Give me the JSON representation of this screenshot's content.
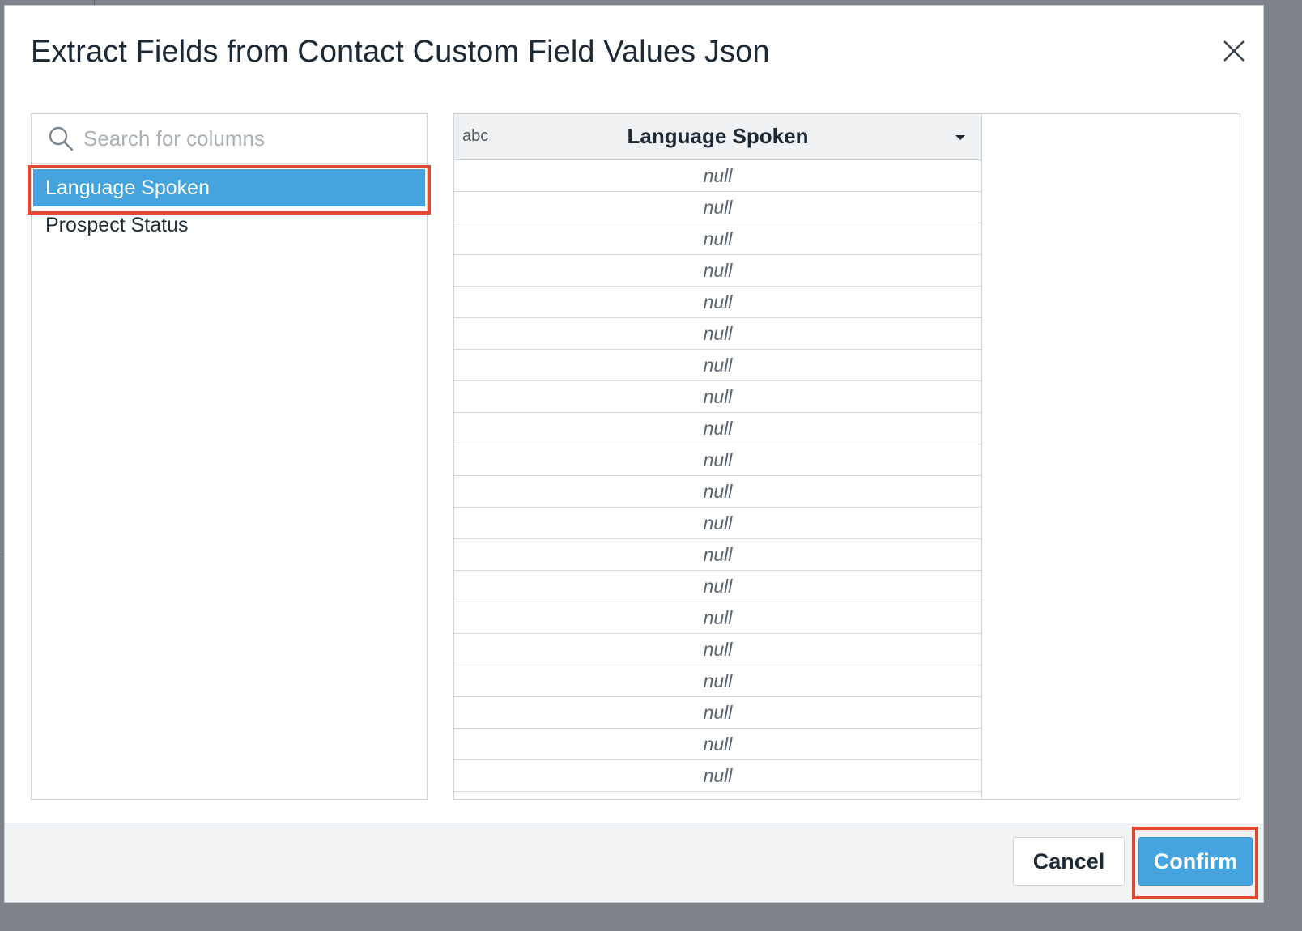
{
  "dialog": {
    "title": "Extract Fields from Contact Custom Field Values Json",
    "close_icon": "close-icon"
  },
  "column_picker": {
    "search_placeholder": "Search for columns",
    "search_value": "",
    "items": [
      {
        "label": "Language Spoken",
        "selected": true
      },
      {
        "label": "Prospect Status",
        "selected": false
      }
    ]
  },
  "preview": {
    "column": {
      "type": "abc",
      "name": "Language Spoken",
      "dropdown_icon": "caret-down-icon"
    },
    "rows": [
      "null",
      "null",
      "null",
      "null",
      "null",
      "null",
      "null",
      "null",
      "null",
      "null",
      "null",
      "null",
      "null",
      "null",
      "null",
      "null",
      "null",
      "null",
      "null",
      "null"
    ]
  },
  "footer": {
    "cancel_label": "Cancel",
    "confirm_label": "Confirm"
  },
  "colors": {
    "accent": "#45a4de",
    "highlight": "#e04a33"
  }
}
